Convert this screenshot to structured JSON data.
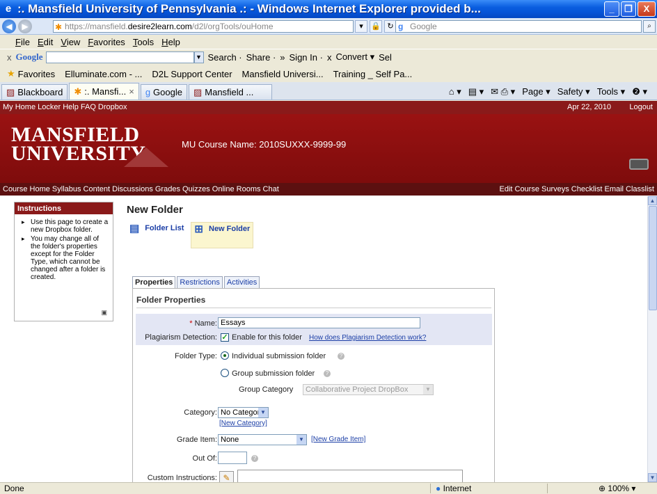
{
  "window": {
    "title": ":. Mansfield University of Pennsylvania .: - Windows Internet Explorer provided b...",
    "min": "_",
    "max": "❐",
    "close": "X"
  },
  "address": {
    "url_host": "https://mansfield.",
    "url_domain": "desire2learn.com",
    "url_path": "/d2l/orgTools/ouHome",
    "search_placeholder": "Google"
  },
  "menu": [
    "File",
    "Edit",
    "View",
    "Favorites",
    "Tools",
    "Help"
  ],
  "google_toolbar": {
    "close": "x",
    "logo": "Google",
    "items": [
      "Search ·",
      "Share ·",
      "»",
      "Sign In ·",
      "x",
      "Convert ▾",
      "Sel"
    ]
  },
  "favorites": {
    "label": "Favorites",
    "items": [
      "Elluminate.com - ...",
      "D2L Support Center",
      "Mansfield Universi...",
      "Training _ Self Pa..."
    ]
  },
  "browser_tabs": [
    {
      "label": "Blackboard",
      "active": false
    },
    {
      "label": ":. Mansfi...",
      "active": true
    },
    {
      "label": "Google",
      "active": false
    },
    {
      "label": "Mansfield ...",
      "active": false
    }
  ],
  "browser_tools": [
    "Page ▾",
    "Safety ▾",
    "Tools ▾",
    "❷ ▾"
  ],
  "d2l": {
    "top_links": "My Home  Locker  Help  FAQ  Dropbox",
    "date": "Apr 22, 2010",
    "logout": "Logout",
    "logo_line1": "MANSFIELD",
    "logo_line2": "UNIVERSITY",
    "course_name": "MU Course Name: 2010SUXXX-9999-99",
    "nav_left": "Course Home  Syllabus  Content  Discussions  Grades  Quizzes  Online Rooms  Chat",
    "nav_right": "Edit Course  Surveys  Checklist  Email  Classlist"
  },
  "instructions": {
    "title": "Instructions",
    "items": [
      "Use this page to create a new Dropbox folder.",
      "You may change all of the folder's properties except for the Folder Type, which cannot be changed after a folder is created."
    ]
  },
  "page": {
    "title": "New Folder",
    "actions": [
      "Folder List",
      "New Folder"
    ],
    "tabs": [
      "Properties",
      "Restrictions",
      "Activities"
    ]
  },
  "form": {
    "section": "Folder Properties",
    "name_label": "Name:",
    "name_required": "*",
    "name_value": "Essays",
    "plag_label": "Plagiarism Detection:",
    "plag_check": "✓",
    "plag_text": "Enable for this folder",
    "plag_link": "How does Plagiarism Detection work?",
    "type_label": "Folder Type:",
    "type_individual": "Individual submission folder",
    "type_group": "Group submission folder",
    "group_category_label": "Group Category",
    "group_category_value": "Collaborative Project DropBox",
    "category_label": "Category:",
    "category_value": "No Category",
    "new_category_link": "[New Category]",
    "grade_item_label": "Grade Item:",
    "grade_item_value": "None",
    "new_grade_item_link": "[New Grade Item]",
    "out_of_label": "Out Of:",
    "custom_instr_label": "Custom Instructions:"
  },
  "status": {
    "left": "Done",
    "zone": "Internet",
    "zoom": "100%"
  }
}
